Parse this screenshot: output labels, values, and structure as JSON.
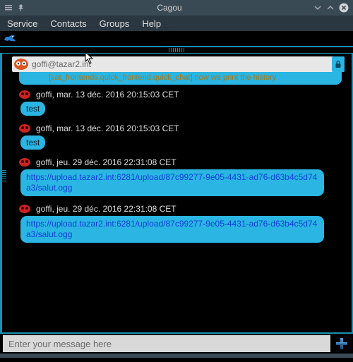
{
  "window": {
    "title": "Cagou"
  },
  "menu": {
    "service": "Service",
    "contacts": "Contacts",
    "groups": "Groups",
    "help": "Help"
  },
  "contact": {
    "jid": "goffi@tazar2.int"
  },
  "history_line": "[sat_frontends.quick_frontend.quick_chat] now we print the history",
  "messages": [
    {
      "author": "goffi",
      "timestamp": "mar. 13 déc. 2016 20:15:03 CET",
      "body": "test",
      "is_link": false
    },
    {
      "author": "goffi",
      "timestamp": "mar. 13 déc. 2016 20:15:03 CET",
      "body": "test",
      "is_link": false
    },
    {
      "author": "goffi",
      "timestamp": "jeu. 29 déc. 2016 22:31:08 CET",
      "body": "https://upload.tazar2.int:6281/upload/87c99277-9e05-4431-ad76-d63b4c5d74a3/salut.ogg",
      "is_link": true
    },
    {
      "author": "goffi",
      "timestamp": "jeu. 29 déc. 2016 22:31:08 CET",
      "body": "https://upload.tazar2.int:6281/upload/87c99277-9e05-4431-ad76-d63b4c5d74a3/salut.ogg",
      "is_link": true
    }
  ],
  "input": {
    "placeholder": "Enter your message here"
  },
  "colors": {
    "accent": "#2ab5e3",
    "border": "#1a8fb6",
    "titlebar": "#3a4a54"
  }
}
